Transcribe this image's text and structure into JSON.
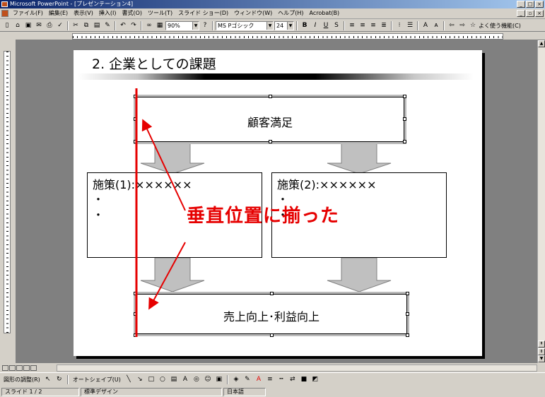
{
  "window": {
    "title": "Microsoft PowerPoint - [プレゼンテーション4]"
  },
  "menu": [
    "ファイル(F)",
    "編集(E)",
    "表示(V)",
    "挿入(I)",
    "書式(O)",
    "ツール(T)",
    "スライド ショー(D)",
    "ウィンドウ(W)",
    "ヘルプ(H)",
    "Acrobat(B)"
  ],
  "toolbar": {
    "zoom": "90%",
    "font": "MS Pゴシック",
    "size": "24",
    "help_label": "よく使う機能(C)"
  },
  "slide": {
    "title": "2. 企業としての課題",
    "top_box": "顧客満足",
    "measure1": {
      "title": "施策(1):××××××",
      "bullet1": "・",
      "bullet2": "・"
    },
    "measure2": {
      "title": "施策(2):××××××",
      "bullet1": "・",
      "bullet2": "・"
    },
    "bottom_box": "売上向上･利益向上",
    "annotation": "垂直位置に揃った"
  },
  "drawbar": {
    "adjust": "図形の調整(R)",
    "autoshape": "オートシェイプ(U)"
  },
  "status": {
    "slide": "スライド 1 / 2",
    "design": "標準デザイン",
    "lang": "日本語"
  },
  "colors": {
    "accent": "#e60000",
    "titlebar": "#0a246a"
  }
}
